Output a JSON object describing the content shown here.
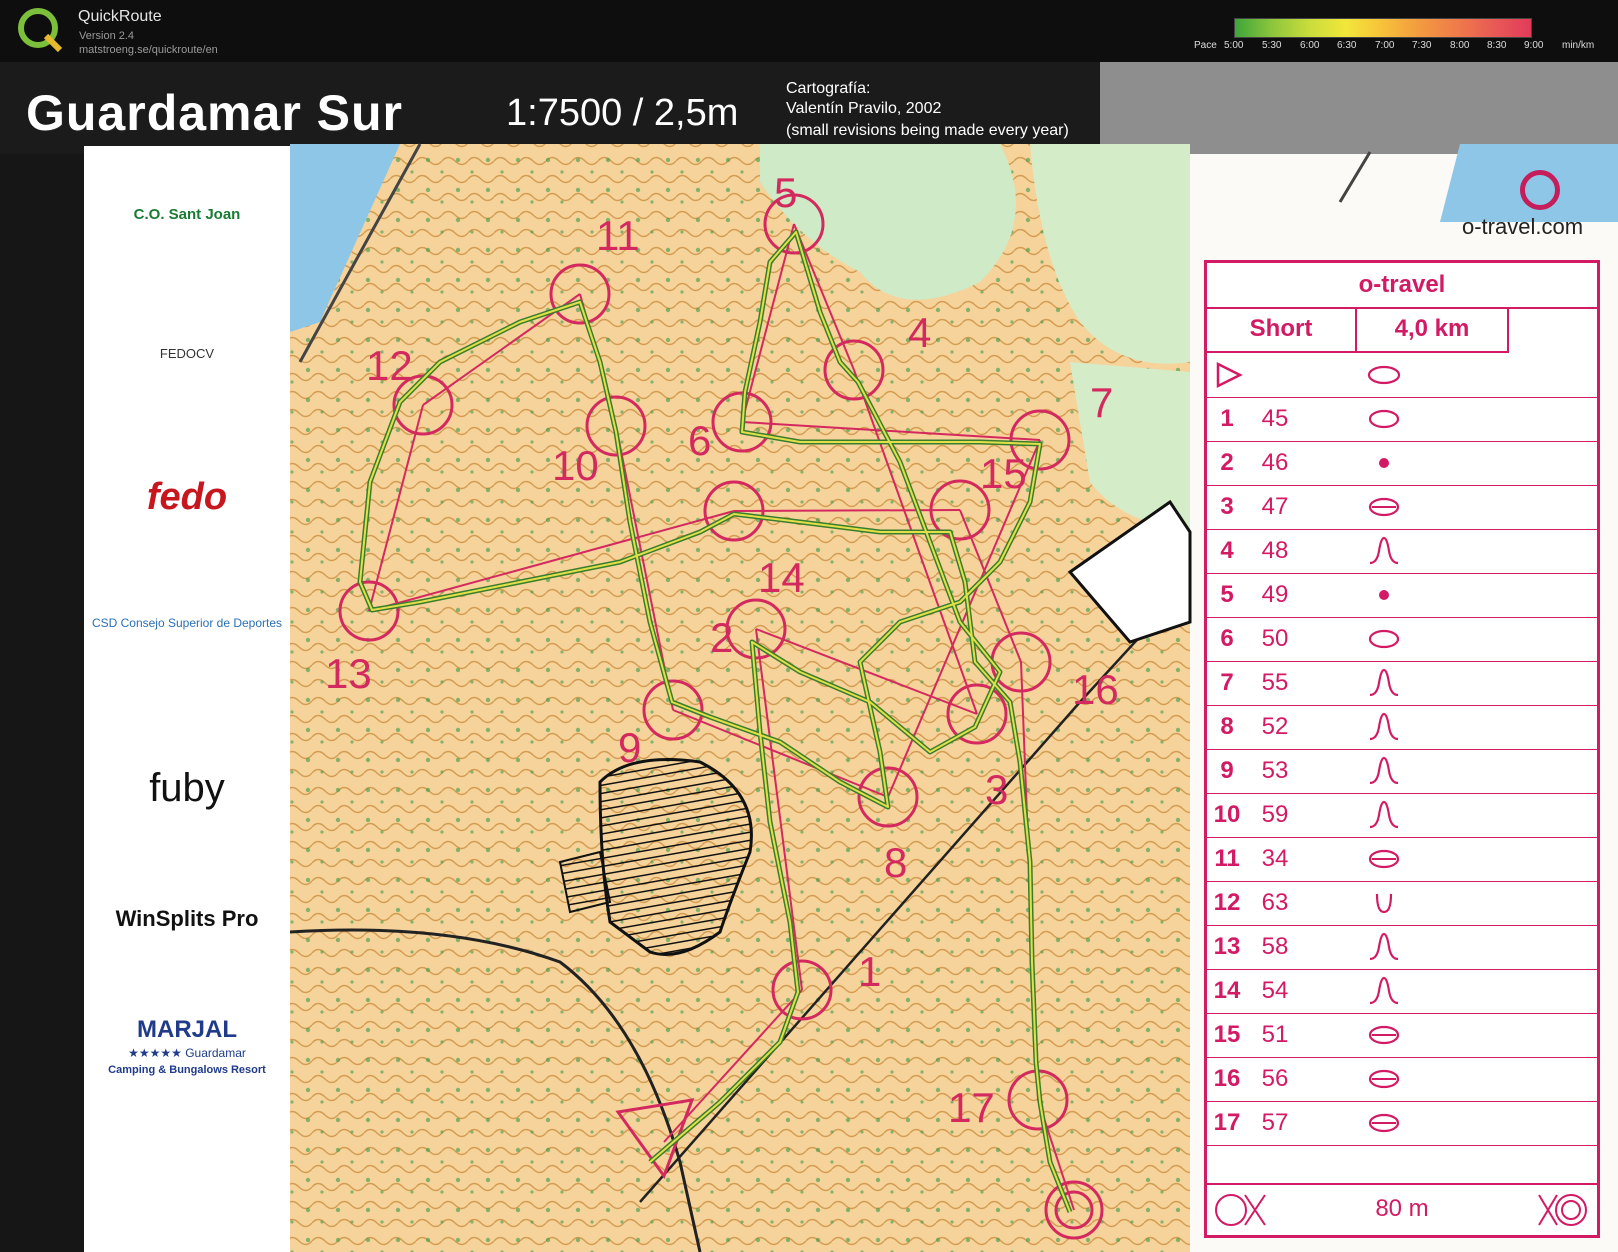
{
  "app": {
    "title": "QuickRoute",
    "version": "Version 2.4",
    "url": "matstroeng.se/quickroute/en"
  },
  "pace_legend": {
    "prefix": "Pace",
    "ticks": [
      "5:00",
      "5:30",
      "6:00",
      "6:30",
      "7:00",
      "7:30",
      "8:00",
      "8:30",
      "9:00"
    ],
    "unit": "min/km",
    "gradient": [
      "#3ea53a",
      "#8cc63c",
      "#c9dc3c",
      "#f2e63a",
      "#f7c13a",
      "#f29a3f",
      "#ef7b4a",
      "#e85a55",
      "#e23b5b"
    ]
  },
  "map": {
    "title": "Guardamar Sur",
    "scale": "1:7500 / 2,5m",
    "cartography_label": "Cartografía:",
    "cartographer": "Valentín Pravilo, 2002",
    "revision_note": "(small revisions being made every year)",
    "brand": "o-travel.com",
    "colors": {
      "course": "#d3295f",
      "route_outer": "#3a7d2c",
      "route_inner": "#e2e04a",
      "terrain": "#f7d7a4",
      "vegetation": "#cbe9c4",
      "water": "#8ec6e8"
    }
  },
  "sponsors": [
    "C.O. Sant Joan",
    "FEDOCV",
    "fedo",
    "CSD Consejo Superior de Deportes",
    "fuby",
    "WinSplits Pro",
    "MARJAL",
    "★★★★★ Guardamar",
    "Camping & Bungalows Resort"
  ],
  "controls": [
    {
      "label": "1"
    },
    {
      "label": "2"
    },
    {
      "label": "3"
    },
    {
      "label": "4"
    },
    {
      "label": "5"
    },
    {
      "label": "6"
    },
    {
      "label": "7"
    },
    {
      "label": "8"
    },
    {
      "label": "9"
    },
    {
      "label": "10"
    },
    {
      "label": "11"
    },
    {
      "label": "12"
    },
    {
      "label": "13"
    },
    {
      "label": "14"
    },
    {
      "label": "15"
    },
    {
      "label": "16"
    },
    {
      "label": "17"
    }
  ],
  "control_descriptions": {
    "title": "o-travel",
    "course": "Short",
    "length": "4,0 km",
    "rows": [
      {
        "num": "1",
        "code": "45"
      },
      {
        "num": "2",
        "code": "46"
      },
      {
        "num": "3",
        "code": "47"
      },
      {
        "num": "4",
        "code": "48"
      },
      {
        "num": "5",
        "code": "49"
      },
      {
        "num": "6",
        "code": "50"
      },
      {
        "num": "7",
        "code": "55"
      },
      {
        "num": "8",
        "code": "52"
      },
      {
        "num": "9",
        "code": "53"
      },
      {
        "num": "10",
        "code": "59"
      },
      {
        "num": "11",
        "code": "34"
      },
      {
        "num": "12",
        "code": "63"
      },
      {
        "num": "13",
        "code": "58"
      },
      {
        "num": "14",
        "code": "54"
      },
      {
        "num": "15",
        "code": "51"
      },
      {
        "num": "16",
        "code": "56"
      },
      {
        "num": "17",
        "code": "57"
      }
    ],
    "finish_distance": "80 m"
  }
}
